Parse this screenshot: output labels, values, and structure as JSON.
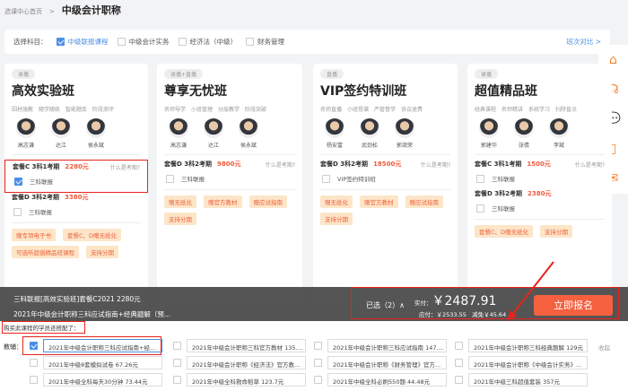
{
  "breadcrumb": {
    "home": "选课中心首页",
    "sep": ">",
    "current": "中级会计职称"
  },
  "filter": {
    "label": "选择科目：",
    "options": [
      {
        "label": "中级联报课程",
        "checked": true
      },
      {
        "label": "中级会计实务",
        "checked": false
      },
      {
        "label": "经济法（中级）",
        "checked": false
      },
      {
        "label": "财务管理",
        "checked": false
      }
    ],
    "compare": "班次对比 >"
  },
  "sidebar": {
    "icons": [
      "home-icon",
      "headset-icon",
      "wechat-icon",
      "mobile-icon",
      "mail-icon"
    ]
  },
  "cards": [
    {
      "tag": "录播",
      "title": "高效实验班",
      "features": [
        "因材施教",
        "随学随练",
        "智能题库",
        "阶段测评"
      ],
      "teachers": [
        "高志谦",
        "达江",
        "侯永斌"
      ],
      "packages": [
        {
          "name": "套餐C 3科1考期",
          "price": "2280元",
          "hint": "什么是考期?",
          "option": "三科联报",
          "checked": true
        },
        {
          "name": "套餐D 3科2考期",
          "price": "3380元",
          "hint": "",
          "option": "三科联报",
          "checked": false
        }
      ],
      "gifts": [
        "赠专项电子书",
        "套餐C、D赠无纸化",
        "可选听超值精品班课程",
        "支持分期"
      ]
    },
    {
      "tag": "录播+直播",
      "title": "尊享无忧班",
      "features": [
        "名师导学",
        "小班管理",
        "分层教学",
        "阶段突破"
      ],
      "teachers": [
        "高志谦",
        "达江",
        "侯永斌"
      ],
      "packages": [
        {
          "name": "套餐D 3科2考期",
          "price": "9800元",
          "hint": "什么是考期?",
          "option": "三科联报",
          "checked": false
        }
      ],
      "gifts": [
        "赠无纸化",
        "赠官方教材",
        "赠应试指南",
        "支持分期"
      ]
    },
    {
      "tag": "直播",
      "title": "VIP签约特训班",
      "features": [
        "名师直播",
        "小班授课",
        "严管督学",
        "协议退费"
      ],
      "teachers": [
        "杨安富",
        "武劲松",
        "郭淑荣"
      ],
      "packages": [
        {
          "name": "套餐D 3科2考期",
          "price": "18500元",
          "hint": "什么是考期?",
          "option": "VIP签约特训班",
          "checked": false
        }
      ],
      "gifts": [
        "赠无纸化",
        "赠官方教材",
        "赠应试指南",
        "支持分期"
      ]
    },
    {
      "tag": "录播",
      "title": "超值精品班",
      "features": [
        "经典课程",
        "名师精讲",
        "系统学习",
        "扫除盲点"
      ],
      "teachers": [
        "郭建华",
        "张倩",
        "李斌"
      ],
      "packages": [
        {
          "name": "套餐C 3科1考期",
          "price": "1500元",
          "hint": "什么是考期?",
          "option": "三科联报",
          "checked": false
        },
        {
          "name": "套餐D 3科2考期",
          "price": "2380元",
          "hint": "",
          "option": "三科联报",
          "checked": false
        }
      ],
      "gifts": [
        "套餐C、D赠无纸化",
        "支持分期"
      ]
    }
  ],
  "cart": {
    "line1": "三科联报[高效实验班]套餐C2021    2280元",
    "line2": "2021年中级会计职称三科应试指南+经典题解（预...",
    "selected": "已选（2）∧",
    "actual_label": "实付：",
    "actual": "￥2487.91",
    "due_label": "应付：",
    "due": "￥2533.55",
    "discount_label": "减免",
    "discount": "￥45.64",
    "enroll": "立即报名"
  },
  "addons": {
    "title": "购买此课程的学员还搭配了：",
    "label": "教辅：",
    "collapse": "收起",
    "items": [
      [
        {
          "text": "2021年中级会计职称三科应试指南+经...",
          "checked": true
        },
        {
          "text": "2021年中级会计职称三科官方教材 135....",
          "checked": false
        },
        {
          "text": "2021年中级会计职称三科应试指南 147....",
          "checked": false
        },
        {
          "text": "2021年中级会计职称三科经典题解 129元",
          "checked": false
        }
      ],
      [
        {
          "text": "2021年中级8套模拟试卷 67.26元",
          "checked": false
        },
        {
          "text": "2021年中级会计职称《经济法》官方教...",
          "checked": false
        },
        {
          "text": "2021年中级会计职称《财务管理》官方...",
          "checked": false
        },
        {
          "text": "2021年中级会计职称《中级会计实务》...",
          "checked": false
        }
      ],
      [
        {
          "text": "2021年中级全科每天30分钟 73.44元",
          "checked": false
        },
        {
          "text": "2021年中级全科救命稻草 123.7元",
          "checked": false
        },
        {
          "text": "2021年中级全科必刷550题 44.48元",
          "checked": false
        },
        {
          "text": "2021年中级三科超值套装 357元",
          "checked": false
        }
      ]
    ]
  }
}
